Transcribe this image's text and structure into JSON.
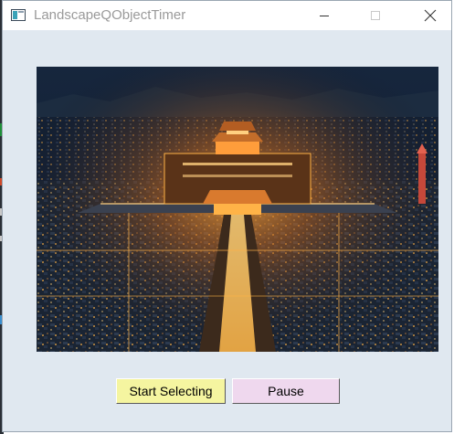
{
  "window": {
    "title": "LandscapeQObjectTimer",
    "controls": {
      "minimize_icon": "minimize-icon",
      "maximize_icon": "maximize-icon",
      "close_icon": "close-icon"
    }
  },
  "image": {
    "description_icon": "landscape-image"
  },
  "buttons": {
    "start_label": "Start Selecting",
    "start_color": "#f5f5a0",
    "pause_label": "Pause",
    "pause_color": "#efd8ee"
  },
  "colors": {
    "client_background": "#e0e8f0",
    "titlebar_background": "#ffffff",
    "title_text": "#9a9a9a"
  }
}
